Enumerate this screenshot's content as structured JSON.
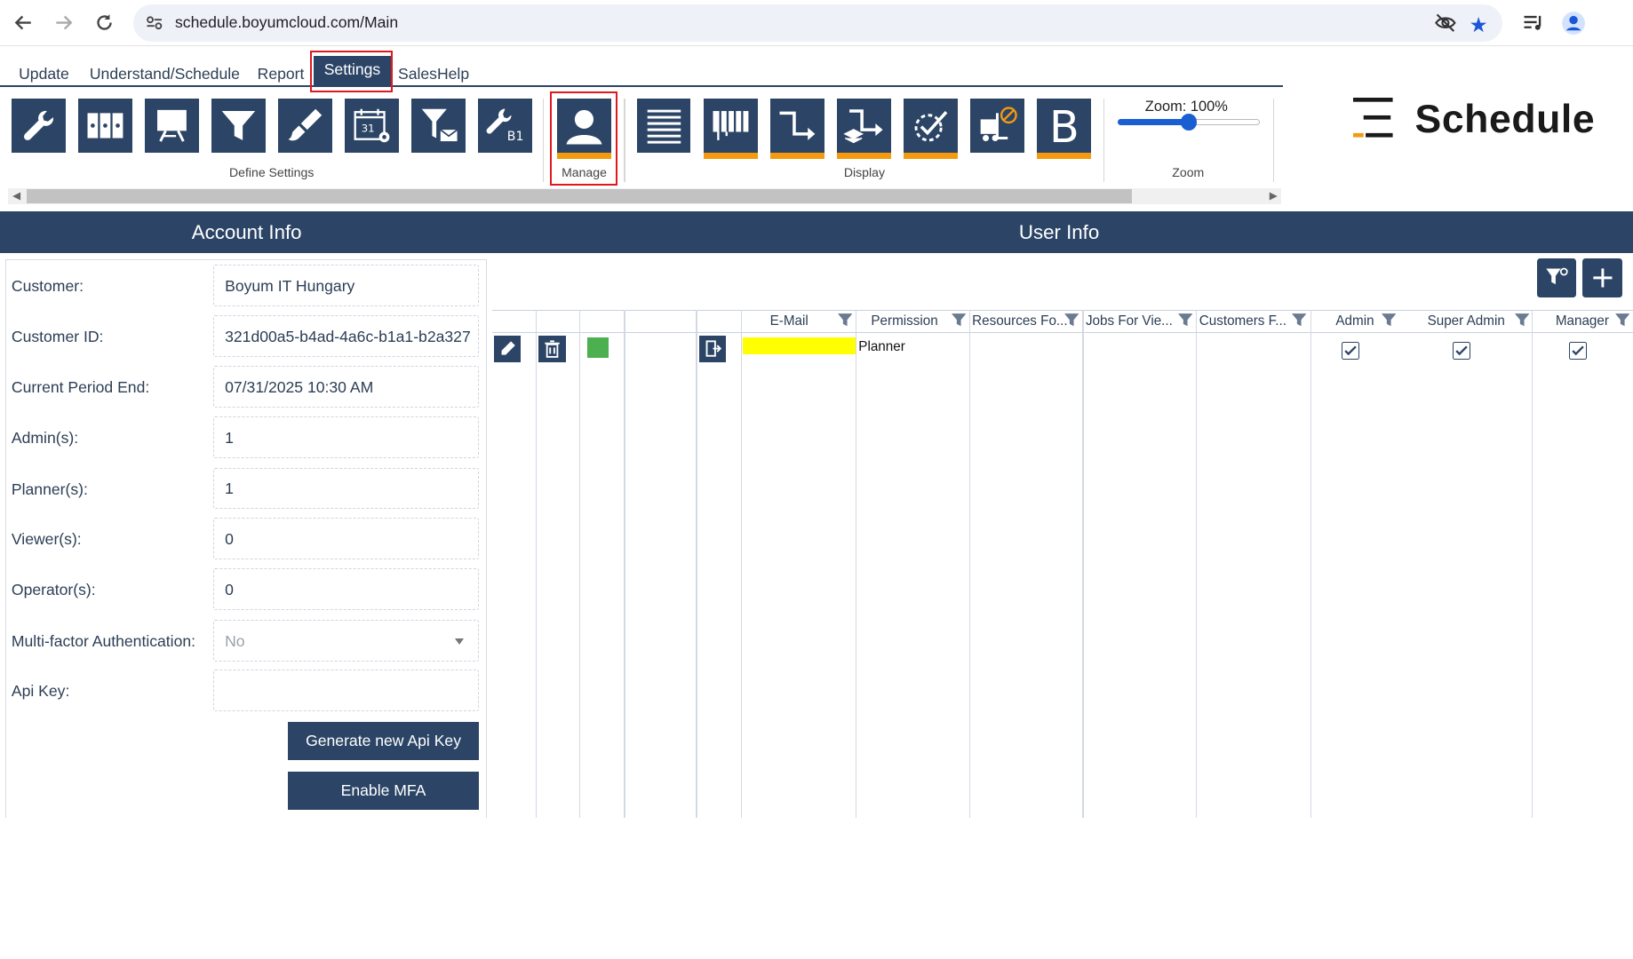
{
  "browser": {
    "url": "schedule.boyumcloud.com/Main"
  },
  "ribbon": {
    "tabs": [
      {
        "label": "Update"
      },
      {
        "label": "Understand/Schedule"
      },
      {
        "label": "Report"
      },
      {
        "label": "Settings",
        "active": true
      },
      {
        "label": "SalesHelp"
      }
    ],
    "groups": {
      "define_settings": "Define Settings",
      "manage": "Manage",
      "display": "Display",
      "zoom": "Zoom"
    },
    "zoom_label": "Zoom: 100%",
    "zoom_level": 0.5,
    "b1_label": "B1",
    "calendar_label": "31",
    "bold_label": "B",
    "brand_name": "Schedule"
  },
  "account_info": {
    "title": "Account Info",
    "fields": [
      {
        "label": "Customer:",
        "value": "Boyum IT Hungary"
      },
      {
        "label": "Customer ID:",
        "value": "321d00a5-b4ad-4a6c-b1a1-b2a327"
      },
      {
        "label": "Current Period End:",
        "value": "07/31/2025 10:30 AM"
      },
      {
        "label": "Admin(s):",
        "value": "1"
      },
      {
        "label": "Planner(s):",
        "value": "1"
      },
      {
        "label": "Viewer(s):",
        "value": "0"
      },
      {
        "label": "Operator(s):",
        "value": "0"
      },
      {
        "label": "Multi-factor Authentication:",
        "value": "No"
      },
      {
        "label": "Api Key:",
        "value": ""
      }
    ],
    "generate_api_key": "Generate new Api Key",
    "enable_mfa": "Enable MFA"
  },
  "user_info": {
    "title": "User Info",
    "columns": [
      "E-Mail",
      "Permission",
      "Resources Fo...",
      "Jobs For Vie...",
      "Customers F...",
      "Admin",
      "Super Admin",
      "Manager"
    ],
    "rows": [
      {
        "email": "",
        "permission": "Planner",
        "admin": true,
        "super_admin": true,
        "manager": true,
        "color": "#4caf50"
      }
    ]
  },
  "colors": {
    "primary": "#2c4566",
    "accent": "#f39a10",
    "highlight": "#e0191e"
  }
}
